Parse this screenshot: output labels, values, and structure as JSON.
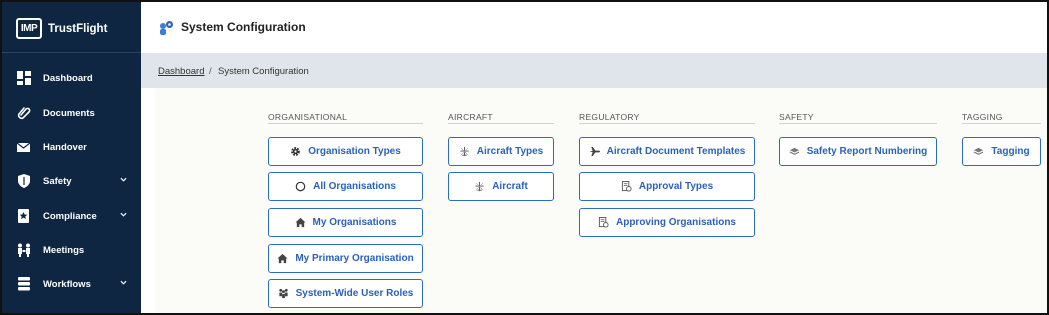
{
  "app": {
    "logo_text": "IMP",
    "brand": "TrustFlight"
  },
  "sidebar": {
    "items": [
      {
        "label": "Dashboard",
        "icon": "dashboard-icon",
        "expandable": false
      },
      {
        "label": "Documents",
        "icon": "paperclip-icon",
        "expandable": false
      },
      {
        "label": "Handover",
        "icon": "envelope-icon",
        "expandable": false
      },
      {
        "label": "Safety",
        "icon": "shield-icon",
        "expandable": true
      },
      {
        "label": "Compliance",
        "icon": "badge-icon",
        "expandable": true
      },
      {
        "label": "Meetings",
        "icon": "meetings-icon",
        "expandable": false
      },
      {
        "label": "Workflows",
        "icon": "workflow-icon",
        "expandable": true
      }
    ]
  },
  "header": {
    "title": "System Configuration",
    "icon": "settings-user-icon"
  },
  "breadcrumb": {
    "link": "Dashboard",
    "separator": "/",
    "current": "System Configuration"
  },
  "columns": [
    {
      "heading": "ORGANISATIONAL",
      "buttons": [
        {
          "label": "Organisation Types",
          "icon": "gear-icon"
        },
        {
          "label": "All Organisations",
          "icon": "circle-icon"
        },
        {
          "label": "My Organisations",
          "icon": "home-icon"
        },
        {
          "label": "My Primary Organisation",
          "icon": "home-icon"
        },
        {
          "label": "System-Wide User Roles",
          "icon": "user-roles-icon"
        }
      ]
    },
    {
      "heading": "AIRCRAFT",
      "buttons": [
        {
          "label": "Aircraft Types",
          "icon": "aircraft-icon"
        },
        {
          "label": "Aircraft",
          "icon": "aircraft-icon"
        }
      ]
    },
    {
      "heading": "REGULATORY",
      "buttons": [
        {
          "label": "Aircraft Document Templates",
          "icon": "plane-icon"
        },
        {
          "label": "Approval Types",
          "icon": "document-check-icon"
        },
        {
          "label": "Approving Organisations",
          "icon": "document-check-icon"
        }
      ]
    },
    {
      "heading": "SAFETY",
      "buttons": [
        {
          "label": "Safety Report Numbering",
          "icon": "layers-icon"
        }
      ]
    },
    {
      "heading": "TAGGING",
      "buttons": [
        {
          "label": "Tagging",
          "icon": "layers-icon"
        }
      ]
    }
  ],
  "colors": {
    "sidebar": "#0e2641",
    "accent": "#2a62b8",
    "crumb_bg": "#dfe5ea"
  }
}
